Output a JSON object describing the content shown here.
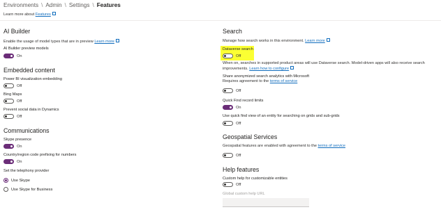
{
  "breadcrumb": {
    "items": [
      "Environments",
      "Admin",
      "Settings"
    ],
    "current": "Features",
    "separator": "\\"
  },
  "learn_more": {
    "text": "Learn more about",
    "link": "Features"
  },
  "left": {
    "ai_builder": {
      "title": "AI Builder",
      "desc": "Enable the usage of model types that are in preview",
      "learn_more": "Learn more",
      "preview_label": "AI Builder preview models",
      "preview_state": "On"
    },
    "embedded": {
      "title": "Embedded content",
      "powerbi_label": "Power BI visualization embedding",
      "powerbi_state": "Off",
      "bing_label": "Bing Maps",
      "bing_state": "Off",
      "social_label": "Prevent social data in Dynamics",
      "social_state": "Off"
    },
    "communications": {
      "title": "Communications",
      "skype_label": "Skype presence",
      "skype_state": "On",
      "country_label": "Country/region code prefixing for numbers",
      "country_state": "On",
      "telephony_label": "Set the telephony provider",
      "option_skype": "Use Skype",
      "option_business": "Use Skype for Business"
    }
  },
  "right": {
    "search": {
      "title": "Search",
      "desc": "Manage how search works in this environment.",
      "learn_more": "Learn more",
      "dataverse_label": "Dataverse search",
      "dataverse_state": "Off",
      "dataverse_desc_1": "When on, searches in supported product areas will use Dataverse search. Model-driven apps will also receive search",
      "dataverse_desc_2": "improvements.",
      "dataverse_link": "Learn how to configure",
      "share_label": "Share anonymized search analytics with Microsoft",
      "share_requires": "Requires agreement to the",
      "share_terms": "terms of service",
      "share_state": "Off",
      "quickfind_label": "Quick Find record limits",
      "quickfind_state": "On",
      "usequick_label": "Use quick find view of an entity for searching on grids and sub-grids",
      "usequick_state": "Off"
    },
    "geo": {
      "title": "Geospatial Services",
      "desc": "Geospatial features are enabled with agreement to the",
      "terms": "terms of service",
      "state": "Off"
    },
    "help": {
      "title": "Help features",
      "custom_label": "Custom help for customizable entities",
      "custom_state": "Off",
      "url_label": "Global custom help URL"
    }
  },
  "colors": {
    "accent": "#6b2d78",
    "link": "#0f6cbd",
    "highlight": "#fbff33"
  }
}
